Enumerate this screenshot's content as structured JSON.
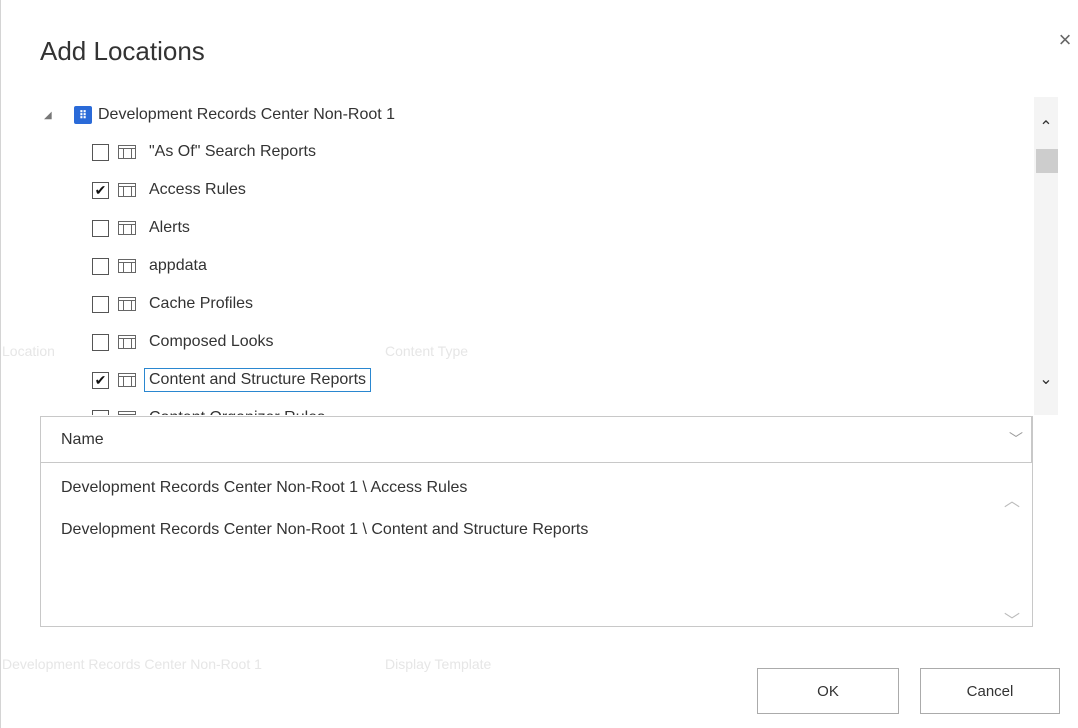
{
  "background": {
    "texts": [
      "Location",
      "Content Type",
      "Development Records Center Non-Root 1",
      "Display Template"
    ]
  },
  "dialog": {
    "title": "Add Locations",
    "close_glyph": "×",
    "tree": {
      "root": {
        "label": "Development Records Center Non-Root 1",
        "icon": "site-icon",
        "expanded": true
      },
      "items": [
        {
          "label": "\"As Of\" Search Reports",
          "checked": false
        },
        {
          "label": "Access Rules",
          "checked": true
        },
        {
          "label": "Alerts",
          "checked": false
        },
        {
          "label": "appdata",
          "checked": false
        },
        {
          "label": "Cache Profiles",
          "checked": false
        },
        {
          "label": "Composed Looks",
          "checked": false
        },
        {
          "label": "Content and Structure Reports",
          "checked": true,
          "selected": true
        },
        {
          "label": "Content Organizer Rules",
          "checked": false
        }
      ]
    },
    "selected_panel": {
      "header": "Name",
      "rows": [
        "Development Records Center Non-Root 1 \\ Access Rules",
        "Development Records Center Non-Root 1 \\ Content and Structure Reports"
      ]
    },
    "buttons": {
      "ok": "OK",
      "cancel": "Cancel"
    }
  }
}
